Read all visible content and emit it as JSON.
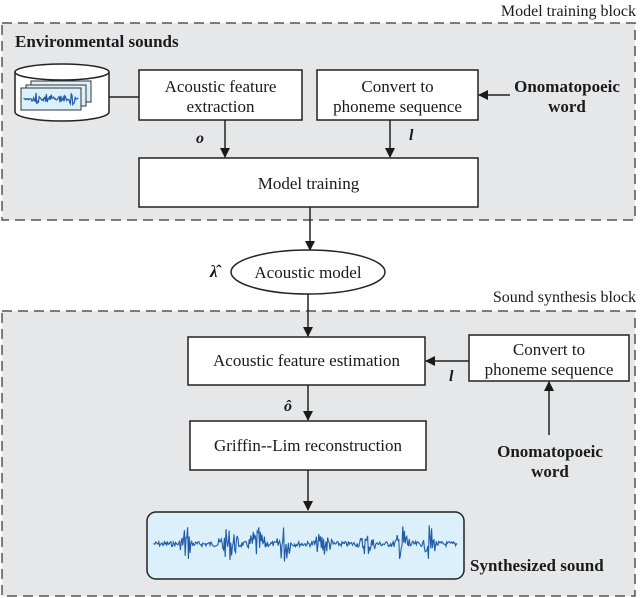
{
  "training_block": {
    "caption": "Model training block",
    "title": "Environmental sounds",
    "feature_extraction": [
      "Acoustic feature",
      "extraction"
    ],
    "convert_phoneme": [
      "Convert to",
      "phoneme sequence"
    ],
    "onomatopoeic_word": [
      "Onomatopoeic",
      "word"
    ],
    "model_training": "Model training",
    "label_o": "o",
    "label_l": "l"
  },
  "acoustic_model": {
    "label": "Acoustic model",
    "symbol": "λ̂"
  },
  "synthesis_block": {
    "caption": "Sound synthesis block",
    "feature_estimation": "Acoustic feature estimation",
    "convert_phoneme": [
      "Convert to",
      "phoneme sequence"
    ],
    "onomatopoeic_word": [
      "Onomatopoeic",
      "word"
    ],
    "griffin_lim": "Griffin--Lim reconstruction",
    "synthesized_sound": "Synthesized sound",
    "label_o_hat": "ô",
    "label_l": "l"
  },
  "colors": {
    "block_fill": "#e6e7e9",
    "waveform": "#1f5ba8",
    "wave_box_fill": "#dcf0fb"
  }
}
